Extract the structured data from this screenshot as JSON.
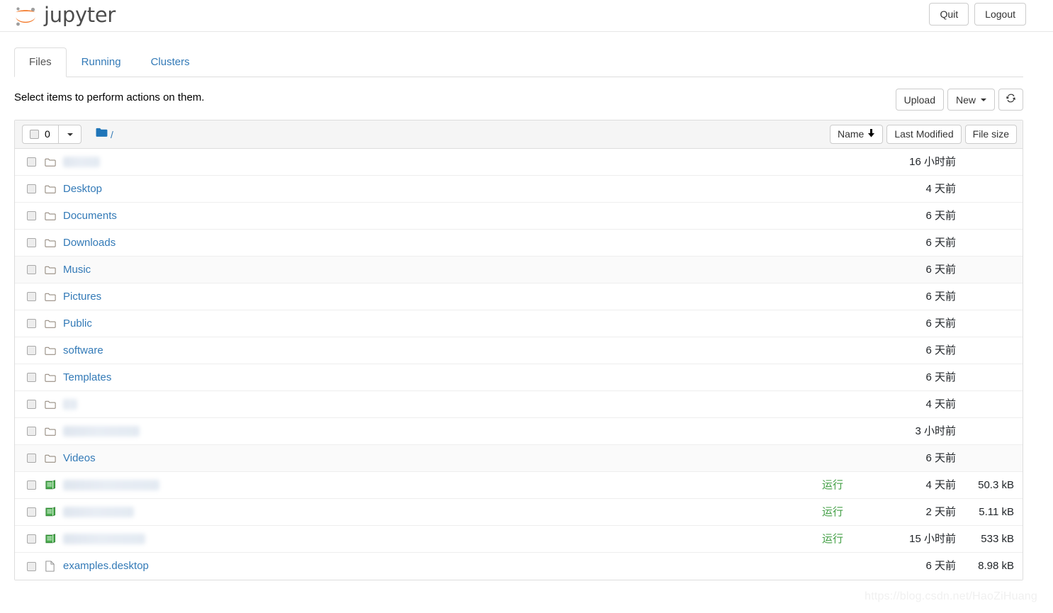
{
  "navbar": {
    "brand_text": "jupyter",
    "logo_colors": {
      "arc": "#f37726",
      "dot": "#9e9e9e"
    },
    "quit_label": "Quit",
    "logout_label": "Logout"
  },
  "tabs": [
    {
      "label": "Files",
      "active": true
    },
    {
      "label": "Running",
      "active": false
    },
    {
      "label": "Clusters",
      "active": false
    }
  ],
  "header": {
    "select_message": "Select items to perform actions on them.",
    "upload_label": "Upload",
    "new_label": "New",
    "refresh_icon": "refresh-icon"
  },
  "toolbar": {
    "selected_count": "0",
    "select_all_checkbox_checked": false,
    "dropdown_icon": "chevron-down-icon",
    "breadcrumb_folder_icon": "folder-icon",
    "breadcrumb_path": "/",
    "sort": {
      "name_label": "Name",
      "name_sort_icon": "arrow-down-icon",
      "last_modified_label": "Last Modified",
      "file_size_label": "File size"
    }
  },
  "colors": {
    "link": "#337ab7",
    "running": "#44a047",
    "folder_icon": "#8a7f72",
    "notebook_icon": "#4caf50",
    "toolbar_bg": "#f5f5f5",
    "border": "#dddddd"
  },
  "files": [
    {
      "type": "folder",
      "name": "",
      "redacted": true,
      "redacted_width": 52,
      "running": "",
      "modified": "16 小时前",
      "size": ""
    },
    {
      "type": "folder",
      "name": "Desktop",
      "redacted": false,
      "running": "",
      "modified": "4 天前",
      "size": ""
    },
    {
      "type": "folder",
      "name": "Documents",
      "redacted": false,
      "running": "",
      "modified": "6 天前",
      "size": ""
    },
    {
      "type": "folder",
      "name": "Downloads",
      "redacted": false,
      "running": "",
      "modified": "6 天前",
      "size": ""
    },
    {
      "type": "folder",
      "name": "Music",
      "redacted": false,
      "running": "",
      "modified": "6 天前",
      "size": ""
    },
    {
      "type": "folder",
      "name": "Pictures",
      "redacted": false,
      "running": "",
      "modified": "6 天前",
      "size": ""
    },
    {
      "type": "folder",
      "name": "Public",
      "redacted": false,
      "running": "",
      "modified": "6 天前",
      "size": ""
    },
    {
      "type": "folder",
      "name": "software",
      "redacted": false,
      "running": "",
      "modified": "6 天前",
      "size": ""
    },
    {
      "type": "folder",
      "name": "Templates",
      "redacted": false,
      "running": "",
      "modified": "6 天前",
      "size": ""
    },
    {
      "type": "folder",
      "name": "",
      "redacted": true,
      "redacted_width": 20,
      "running": "",
      "modified": "4 天前",
      "size": ""
    },
    {
      "type": "folder",
      "name": "",
      "redacted": true,
      "redacted_width": 108,
      "running": "",
      "modified": "3 小时前",
      "size": ""
    },
    {
      "type": "folder",
      "name": "Videos",
      "redacted": false,
      "running": "",
      "modified": "6 天前",
      "size": ""
    },
    {
      "type": "notebook",
      "name": "",
      "redacted": true,
      "redacted_width": 136,
      "running": "运行",
      "modified": "4 天前",
      "size": "50.3 kB"
    },
    {
      "type": "notebook",
      "name": "",
      "redacted": true,
      "redacted_width": 100,
      "running": "运行",
      "modified": "2 天前",
      "size": "5.11 kB"
    },
    {
      "type": "notebook",
      "name": "",
      "redacted": true,
      "redacted_width": 116,
      "running": "运行",
      "modified": "15 小时前",
      "size": "533 kB"
    },
    {
      "type": "file",
      "name": "examples.desktop",
      "redacted": false,
      "running": "",
      "modified": "6 天前",
      "size": "8.98 kB"
    }
  ],
  "watermark": "https://blog.csdn.net/HaoZiHuang"
}
